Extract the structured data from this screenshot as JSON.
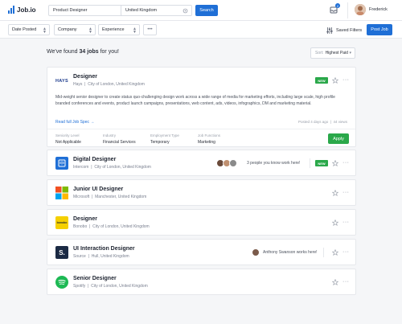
{
  "brand": {
    "name": "Job.io"
  },
  "search": {
    "keyword": "Product Designer",
    "location": "United Kingdom",
    "button": "Search"
  },
  "notifications": {
    "count": "2"
  },
  "user": {
    "name": "Frederick"
  },
  "filters": {
    "date_posted": "Date Posted",
    "company": "Company",
    "experience": "Experience",
    "more": "•••",
    "saved_filters": "Saved Filters",
    "post_job": "Post Job"
  },
  "results": {
    "prefix": "We've found ",
    "count": "34 jobs",
    "suffix": " for you!"
  },
  "sort": {
    "label": "Sort:",
    "value": "Highest Paid"
  },
  "featured_job": {
    "title": "Designer",
    "company": "Hays",
    "location": "City of London, United Kingdom",
    "company_logo_text": "HAYS",
    "badge": "NEW",
    "description": "Mid-weight senior designer to create status quo-challenging design work across a wide range of media for marketing efforts, including large scale, high profile branded conferences and events, product launch campaigns, presentations, web content, ads, videos, infographics, DM and marketing material.",
    "read_spec": "Read full Job Spec →",
    "posted": "Posted 4 days ago",
    "views": "44 views",
    "attributes": [
      {
        "key": "Seniority Level",
        "value": "Not Applicable"
      },
      {
        "key": "Industry",
        "value": "Financial Services"
      },
      {
        "key": "Employment Type",
        "value": "Temporary"
      },
      {
        "key": "Job Functions",
        "value": "Marketing"
      }
    ],
    "apply": "Apply"
  },
  "jobs": [
    {
      "title": "Digital Designer",
      "company": "Intercom",
      "location": "City of London, United Kingdom",
      "social": "3 people you know work here!",
      "badge": "NEW"
    },
    {
      "title": "Junior UI Designer",
      "company": "Microsoft",
      "location": "Manchester, United Kingdom"
    },
    {
      "title": "Designer",
      "company": "Bonobo",
      "location": "City of London, United Kingdom",
      "company_logo_text": "bonobo"
    },
    {
      "title": "UI Interaction Designer",
      "company": "Source",
      "location": "Hull, United Kingdom",
      "social": "Anthony Swanson works here!",
      "company_logo_text": "S."
    },
    {
      "title": "Senior Designer",
      "company": "Spotify",
      "location": "City of London, United Kingdom"
    }
  ],
  "colors": {
    "accent": "#1f6fd6",
    "success": "#2aa84a"
  }
}
